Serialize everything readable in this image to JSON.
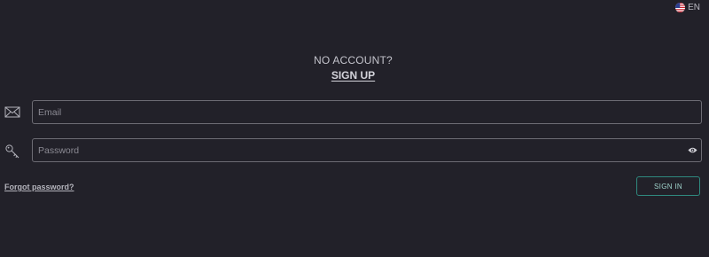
{
  "language": {
    "code": "EN",
    "flag_icon": "us-flag-icon"
  },
  "signup_prompt": {
    "question": "NO ACCOUNT?",
    "link_label": "SIGN UP"
  },
  "form": {
    "email": {
      "placeholder": "Email",
      "value": "",
      "icon": "envelope-icon"
    },
    "password": {
      "placeholder": "Password",
      "value": "",
      "icon": "key-icon",
      "toggle_icon": "eye-icon"
    },
    "forgot_label": "Forgot password?",
    "submit_label": "SIGN IN"
  },
  "colors": {
    "background": "#222129",
    "field_border": "#6d6c74",
    "accent": "#2f8a7f"
  }
}
